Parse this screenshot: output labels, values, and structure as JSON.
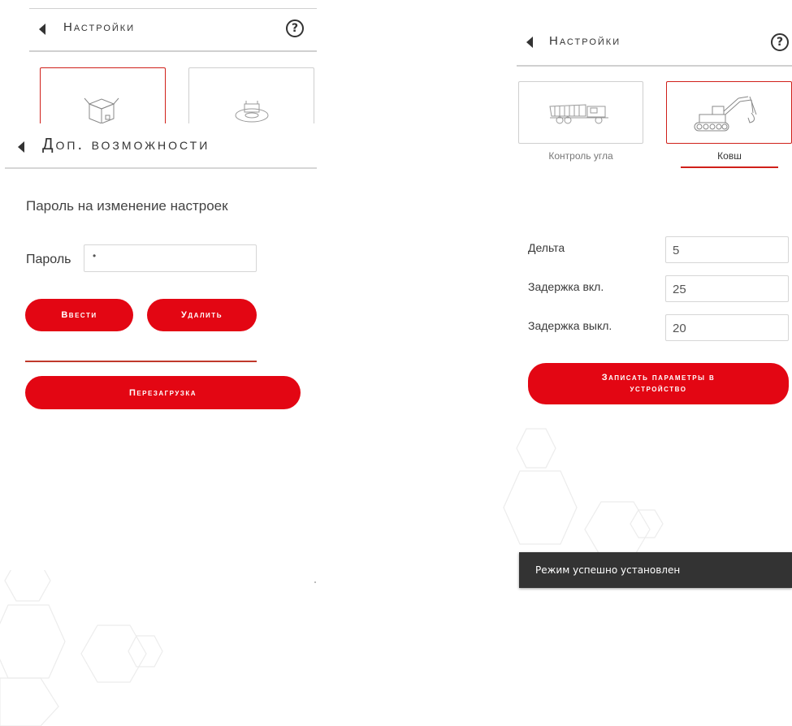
{
  "left": {
    "settings_header": {
      "title": "Настройки",
      "help": "?"
    },
    "overlay_header": {
      "title": "Доп. возможности"
    },
    "section_title": "Пароль на изменение настроек",
    "password": {
      "label": "Пароль",
      "value": "•"
    },
    "enter_button": "Ввести",
    "delete_button": "Удалить",
    "reboot_button": "Перезагрузка"
  },
  "right": {
    "settings_header": {
      "title": "Настройки",
      "help": "?"
    },
    "modes": [
      {
        "label": "Контроль угла",
        "icon": "dump-truck-icon",
        "selected": false
      },
      {
        "label": "Ковш",
        "icon": "excavator-icon",
        "selected": true
      }
    ],
    "params": [
      {
        "label": "Дельта",
        "value": "5"
      },
      {
        "label": "Задержка вкл.",
        "value": "25"
      },
      {
        "label": "Задержка выкл.",
        "value": "20"
      }
    ],
    "write_button": "Записать параметры в устройство",
    "toast": "Режим успешно установлен"
  },
  "colors": {
    "accent": "#e30613",
    "selected_border": "#d0201a",
    "toast_bg": "#333333"
  }
}
